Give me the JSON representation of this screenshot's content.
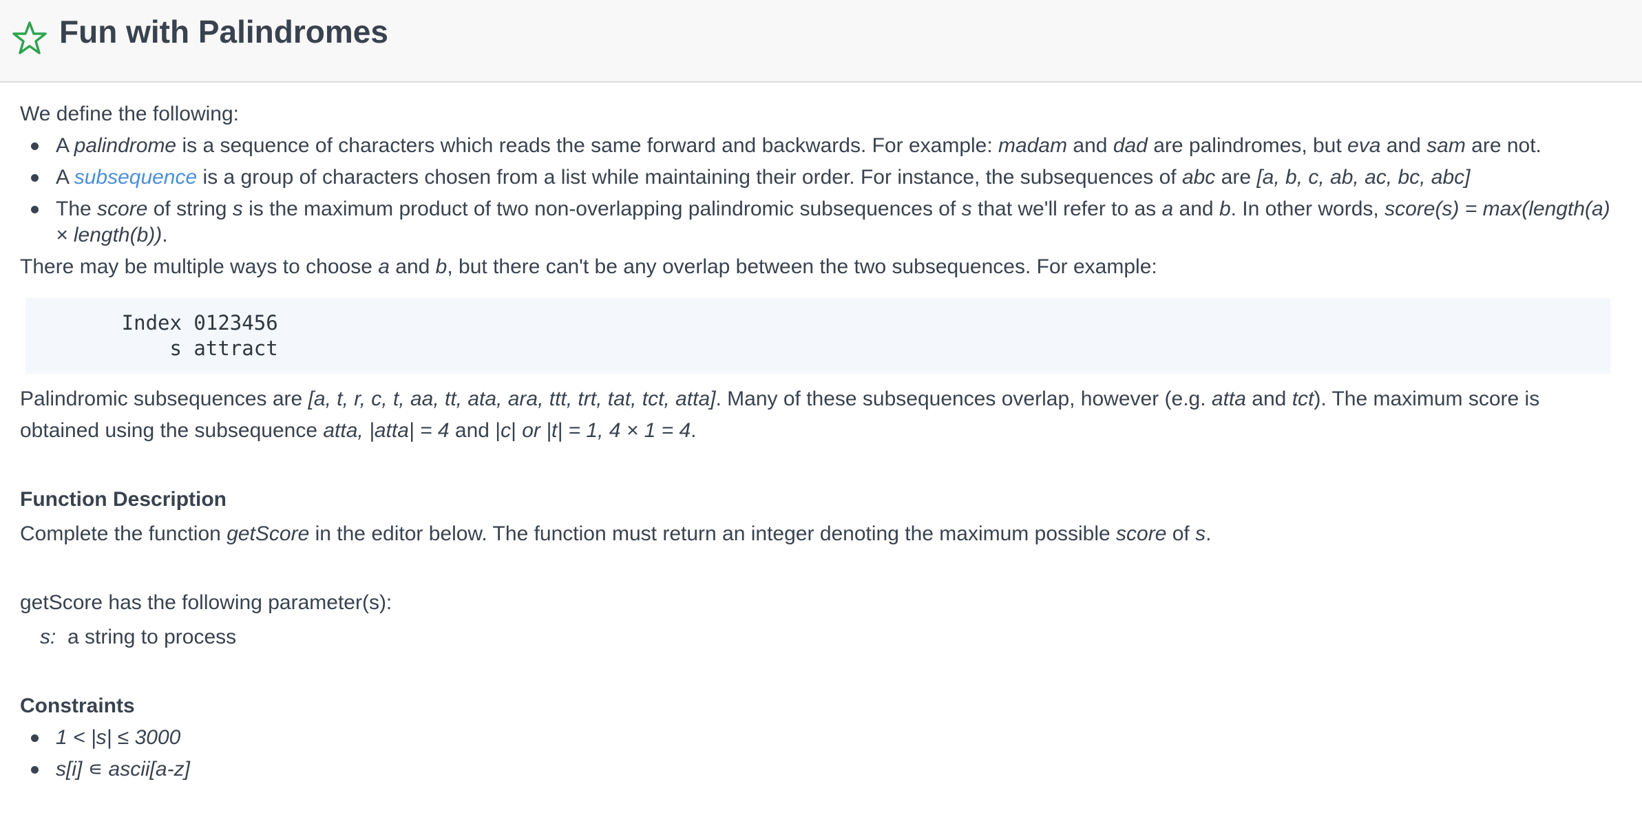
{
  "header": {
    "title": "Fun with Palindromes",
    "icon": "star-outline-icon",
    "icon_color": "#2ea44f"
  },
  "intro": "We define the following:",
  "definitions": {
    "palindrome": {
      "p1": "A ",
      "term": "palindrome",
      "p2": " is a sequence of characters which reads the same forward and backwards. For example: ",
      "ex1": "madam",
      "p3": " and ",
      "ex2": "dad",
      "p4": " are palindromes, but ",
      "ex3": "eva",
      "p5": " and ",
      "ex4": "sam",
      "p6": " are not."
    },
    "subsequence": {
      "p1": "A ",
      "link": "subsequence",
      "p2": " is a group of characters chosen from a list while maintaining their order. For instance, the subsequences of ",
      "ex1": "abc",
      "p3": " are ",
      "ex2": "[a, b, c, ab, ac, bc, abc]"
    },
    "score": {
      "p1": "The ",
      "term": "score",
      "p2": " of string ",
      "var_s": "s",
      "p3": " is the maximum product of two non-overlapping palindromic subsequences of ",
      "var_s2": "s",
      "p4": " that we'll refer to as ",
      "var_a": "a",
      "p5": " and ",
      "var_b": "b",
      "p6": ". In other words, ",
      "formula": "score(s) = max(length(a) × length(b))",
      "p7": "."
    }
  },
  "overlap": {
    "p1": "There may be multiple ways to choose ",
    "var_a": "a",
    "p2": " and ",
    "var_b": "b",
    "p3": ", but there can't be any overlap between the two subsequences. For example:"
  },
  "code": {
    "line1": "        Index 0123456",
    "line2": "            s attract"
  },
  "explanation": {
    "p1": "Palindromic subsequences are ",
    "list": "[a, t, r, c, t, aa, tt, ata, ara, ttt, trt, tat, tct, atta]",
    "p2": ". Many of these subsequences overlap, however (e.g. ",
    "ex1": "atta",
    "p3": " and ",
    "ex2": "tct",
    "p4": "). The maximum score is obtained using the subsequence ",
    "f1": "atta, |atta| = 4",
    "p5": " and |",
    "f2": "c",
    "p6": "| ",
    "f3": "or |t| = 1, 4 × 1 = 4",
    "p7": "."
  },
  "function_description": {
    "heading": "Function Description",
    "p1": "Complete the function ",
    "fn": "getScore",
    "p2": " in the editor below. The function must return an integer denoting the maximum possible ",
    "term": "score",
    "p3": " of ",
    "var_s": "s",
    "p4": ".",
    "params_intro": "getScore has the following parameter(s):",
    "param_name": "s:",
    "param_desc": "  a string to process"
  },
  "constraints": {
    "heading": "Constraints",
    "items": [
      "1 < |s| ≤ 3000",
      "s[i] ∊ ascii[a-z]"
    ]
  }
}
